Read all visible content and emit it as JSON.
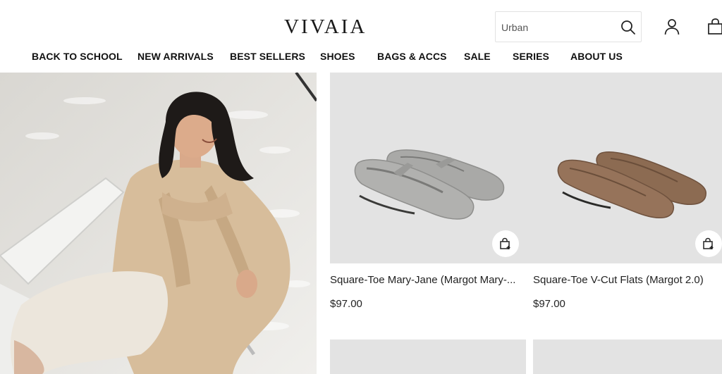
{
  "header": {
    "logo": "VIVAIA",
    "search": {
      "value": "Urban",
      "placeholder": "Urban"
    }
  },
  "nav": {
    "items": [
      {
        "label": "BACK TO SCHOOL"
      },
      {
        "label": "NEW ARRIVALS"
      },
      {
        "label": "BEST SELLERS"
      },
      {
        "label": "SHOES"
      },
      {
        "label": "BAGS & ACCS"
      },
      {
        "label": "SALE"
      },
      {
        "label": "SERIES"
      },
      {
        "label": "ABOUT US"
      }
    ]
  },
  "products": [
    {
      "title": "Square-Toe Mary-Jane (Margot Mary-...",
      "price": "$97.00",
      "color": "#a9a9a7"
    },
    {
      "title": "Square-Toe V-Cut Flats (Margot 2.0)",
      "price": "$97.00",
      "color": "#8c6b52"
    }
  ],
  "icons": {
    "search": "search-icon",
    "user": "user-icon",
    "bag": "shopping-bag-icon",
    "quick_add": "add-to-bag-icon"
  }
}
